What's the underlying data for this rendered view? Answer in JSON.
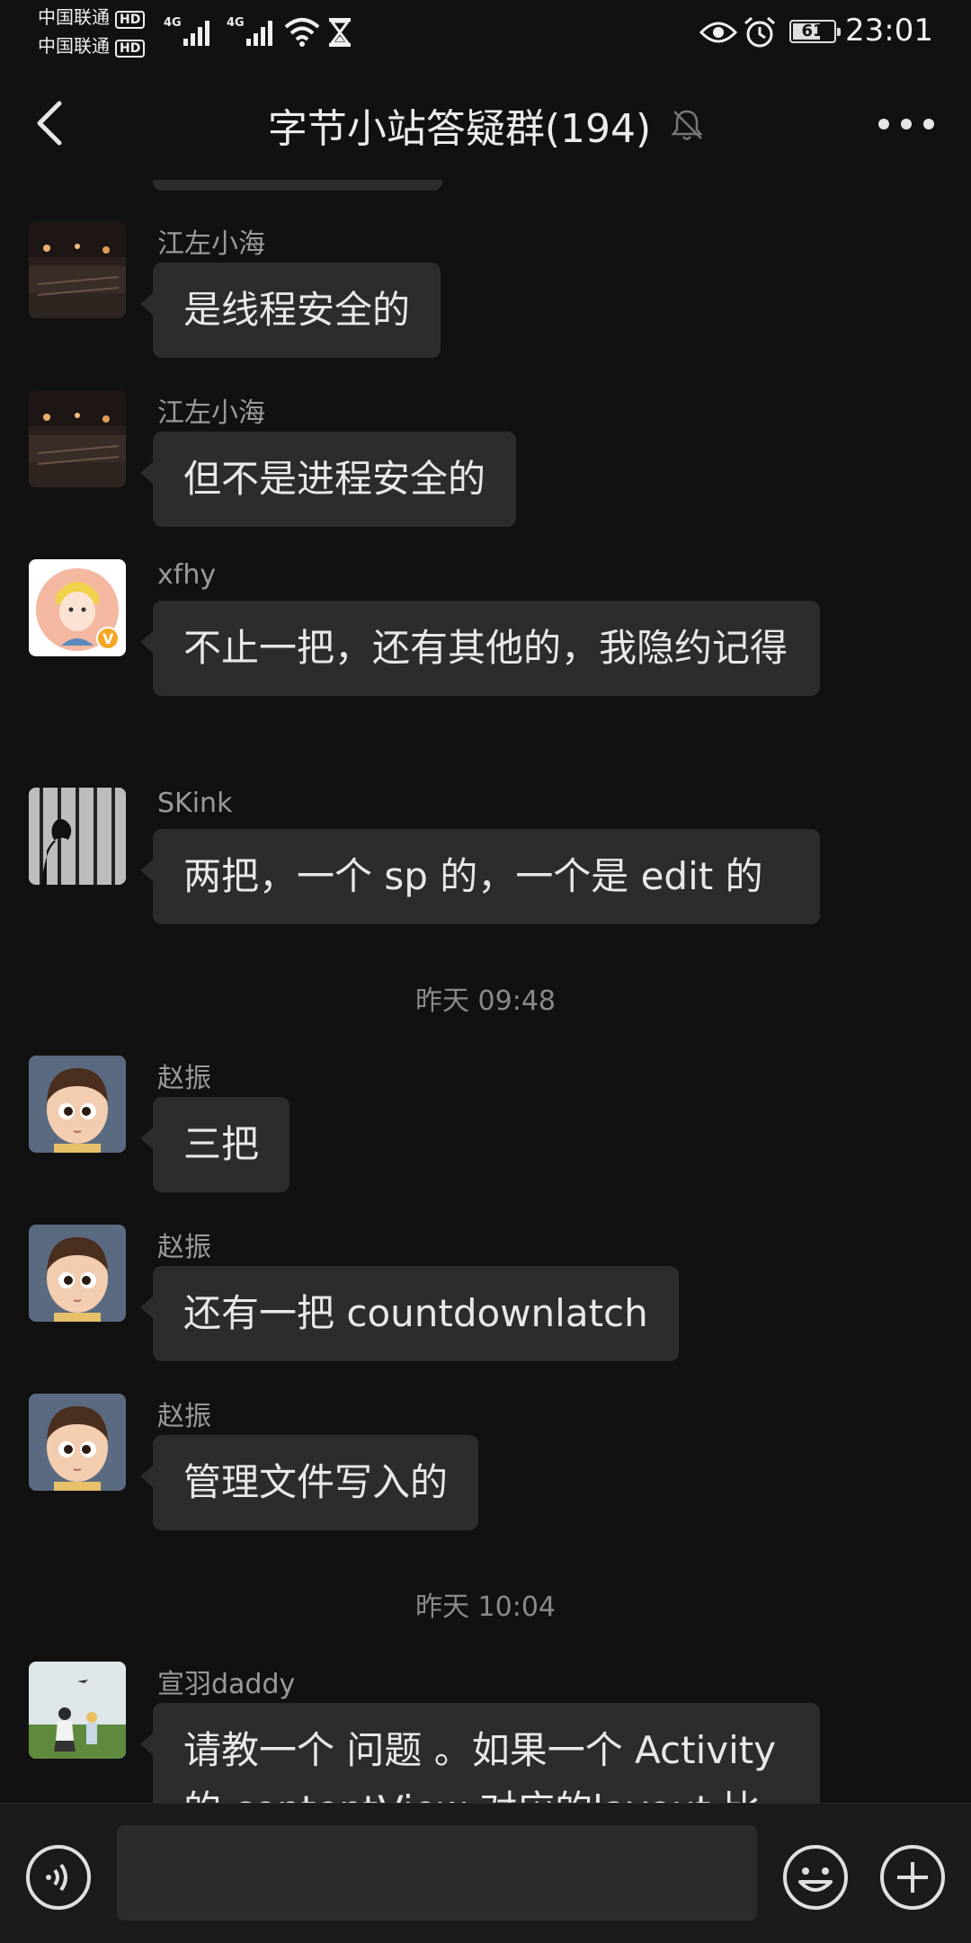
{
  "status_bar": {
    "carrier_1": "中国联通",
    "carrier_2": "中国联通",
    "hd": "HD",
    "network_1": "4G",
    "network_2": "4G",
    "battery": "61",
    "time": "23:01"
  },
  "nav": {
    "title": "字节小站答疑群(194)"
  },
  "messages": [
    {
      "sender": "江左小海",
      "text": "是线程安全的"
    },
    {
      "sender": "江左小海",
      "text": "但不是进程安全的"
    },
    {
      "sender": "xfhy",
      "text": "不止一把，还有其他的，我隐约记得"
    },
    {
      "sender": "SKink",
      "text": "两把，一个 sp 的，一个是 edit 的"
    },
    {
      "timestamp": "昨天 09:48"
    },
    {
      "sender": "赵振",
      "text": "三把"
    },
    {
      "sender": "赵振",
      "text": "还有一把 countdownlatch"
    },
    {
      "sender": "赵振",
      "text": "管理文件写入的"
    },
    {
      "timestamp": "昨天 10:04"
    },
    {
      "sender": "宣羽daddy",
      "text": "请教一个 问题 。如果一个 Activity 的 contentView 对应的layout 比"
    }
  ],
  "input": {
    "value": "",
    "placeholder": ""
  },
  "colors": {
    "background": "#111111",
    "bubble": "#2c2c2c",
    "sender": "#9a9a9a",
    "input_bar": "#1b1b1b"
  },
  "icons": [
    "back-arrow-icon",
    "mute-bell-icon",
    "more-icon",
    "voice-icon",
    "emoji-icon",
    "plus-icon",
    "signal-icon",
    "wifi-icon",
    "hourglass-icon",
    "eye-icon",
    "alarm-icon",
    "battery-icon"
  ]
}
